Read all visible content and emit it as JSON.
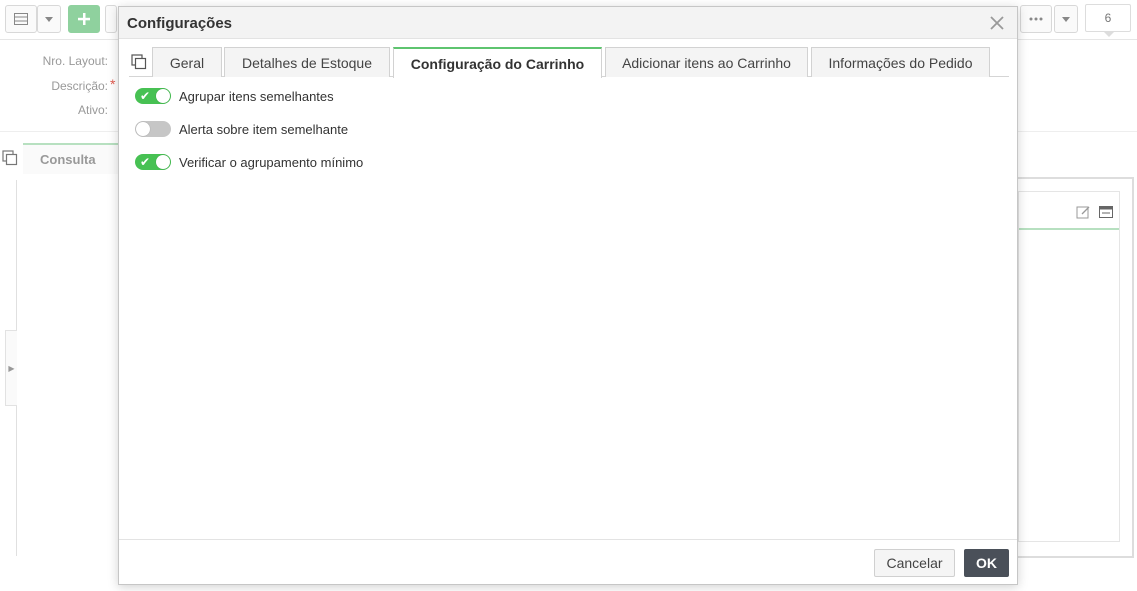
{
  "background": {
    "toolbar": {
      "counter": "6"
    },
    "form": {
      "layout_label": "Nro. Layout:",
      "description_label": "Descrição:",
      "required_mark": "*",
      "active_label": "Ativo:"
    },
    "tab_label": "Consulta",
    "icons": [
      "grid-icon",
      "chevron-down-icon",
      "plus-icon",
      "more-icon",
      "copy-icon",
      "edit-icon",
      "window-icon",
      "arrow-right-icon"
    ]
  },
  "modal": {
    "title": "Configurações",
    "tabs": [
      {
        "label": "Geral",
        "active": false
      },
      {
        "label": "Detalhes de Estoque",
        "active": false
      },
      {
        "label": "Configuração do Carrinho",
        "active": true
      },
      {
        "label": "Adicionar itens ao Carrinho",
        "active": false
      },
      {
        "label": "Informações do Pedido",
        "active": false
      }
    ],
    "options": [
      {
        "label": "Agrupar itens semelhantes",
        "enabled": true
      },
      {
        "label": "Alerta sobre item semelhante",
        "enabled": false
      },
      {
        "label": "Verificar o agrupamento mínimo",
        "enabled": true
      }
    ],
    "footer": {
      "cancel_label": "Cancelar",
      "ok_label": "OK"
    }
  },
  "colors": {
    "accent_green": "#47c153",
    "tab_active_border": "#5ec46f",
    "ok_button": "#4a5059"
  }
}
